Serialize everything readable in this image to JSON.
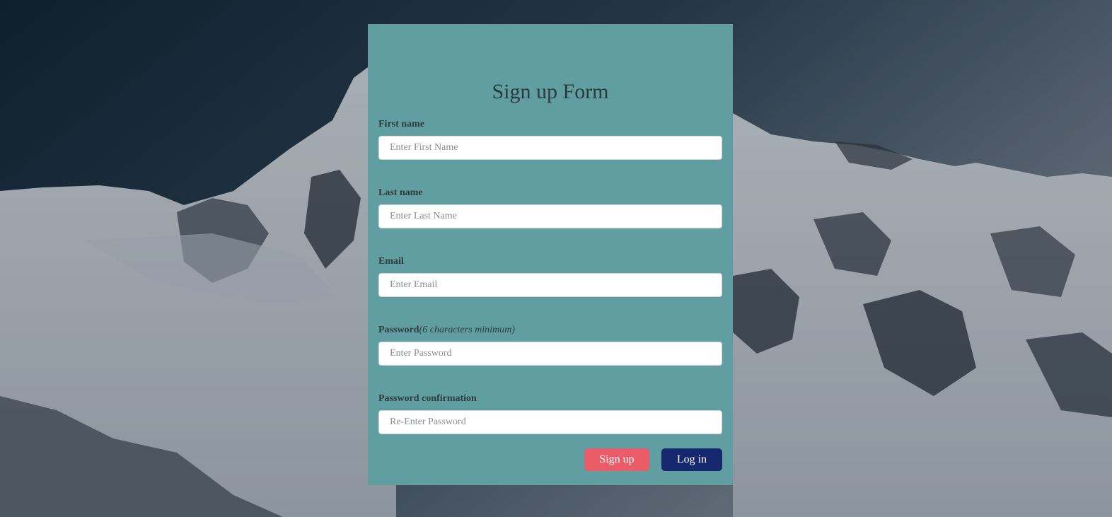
{
  "form": {
    "title": "Sign up Form",
    "fields": [
      {
        "label": "First name",
        "hint": "",
        "placeholder": "Enter First Name",
        "value": ""
      },
      {
        "label": "Last name",
        "hint": "",
        "placeholder": "Enter Last Name",
        "value": ""
      },
      {
        "label": "Email",
        "hint": "",
        "placeholder": "Enter Email",
        "value": ""
      },
      {
        "label": "Password",
        "hint": "(6 characters minimum)",
        "placeholder": "Enter Password",
        "value": ""
      },
      {
        "label": "Password confirmation",
        "hint": "",
        "placeholder": "Re-Enter Password",
        "value": ""
      }
    ],
    "buttons": {
      "signup_label": "Sign up",
      "login_label": "Log in"
    }
  },
  "colors": {
    "card_background": "#609ea2",
    "signup_button": "#ea5d68",
    "login_button": "#15286d",
    "title_text": "#2b3a3c"
  },
  "background": {
    "description_icon": "snowy-mountain-photo"
  }
}
